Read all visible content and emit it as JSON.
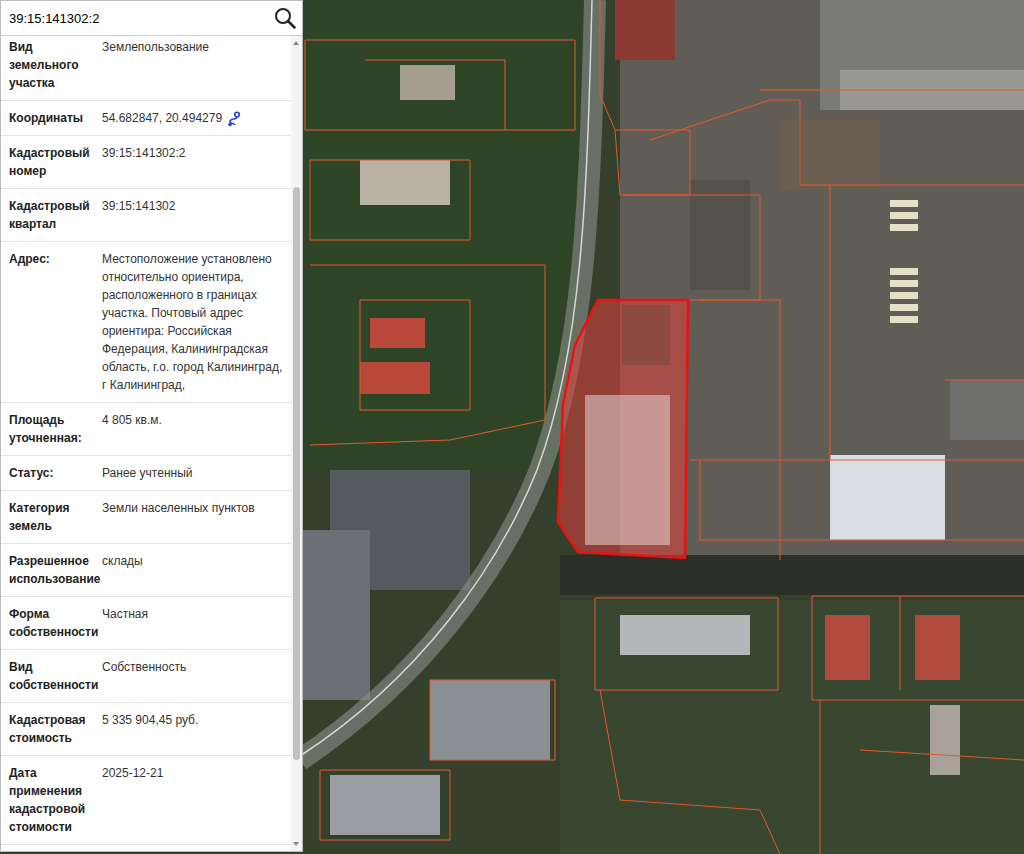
{
  "search": {
    "value": "39:15:141302:2",
    "icon": "search"
  },
  "rows": [
    {
      "label": "Вид земельного участка",
      "value": "Землепользование",
      "kind": "text"
    },
    {
      "label": "Координаты",
      "value": "54.682847, 20.494279",
      "kind": "coords"
    },
    {
      "label": "Кадастровый номер",
      "value": "39:15:141302:2",
      "kind": "text"
    },
    {
      "label": "Кадастровый квартал",
      "value": "39:15:141302",
      "kind": "text"
    },
    {
      "label": "Адрес:",
      "value": "Местоположение установлено относительно ориентира, расположенного в границах участка. Почтовый адрес ориентира: Российская Федерация, Калининградская область, г.о. город Калининград, г Калининград,",
      "kind": "text"
    },
    {
      "label": "Площадь уточненная:",
      "value": "4 805 кв.м.",
      "kind": "text"
    },
    {
      "label": "Статус:",
      "value": "Ранее учтенный",
      "kind": "text"
    },
    {
      "label": "Категория земель",
      "value": "Земли населенных пунктов",
      "kind": "text"
    },
    {
      "label": "Разрешенное использование",
      "value": "склады",
      "kind": "text"
    },
    {
      "label": "Форма собственности",
      "value": "Частная",
      "kind": "text"
    },
    {
      "label": "Вид собственности",
      "value": "Собственность",
      "kind": "text"
    },
    {
      "label": "Кадастровая стоимость",
      "value": "5 335 904,45 руб.",
      "kind": "text"
    },
    {
      "label": "Дата применения кадастровой стоимости",
      "value": "2025-12-21",
      "kind": "text"
    }
  ],
  "scrollbar": {
    "level": 0.64
  },
  "map": {
    "parcel_selected": true
  }
}
